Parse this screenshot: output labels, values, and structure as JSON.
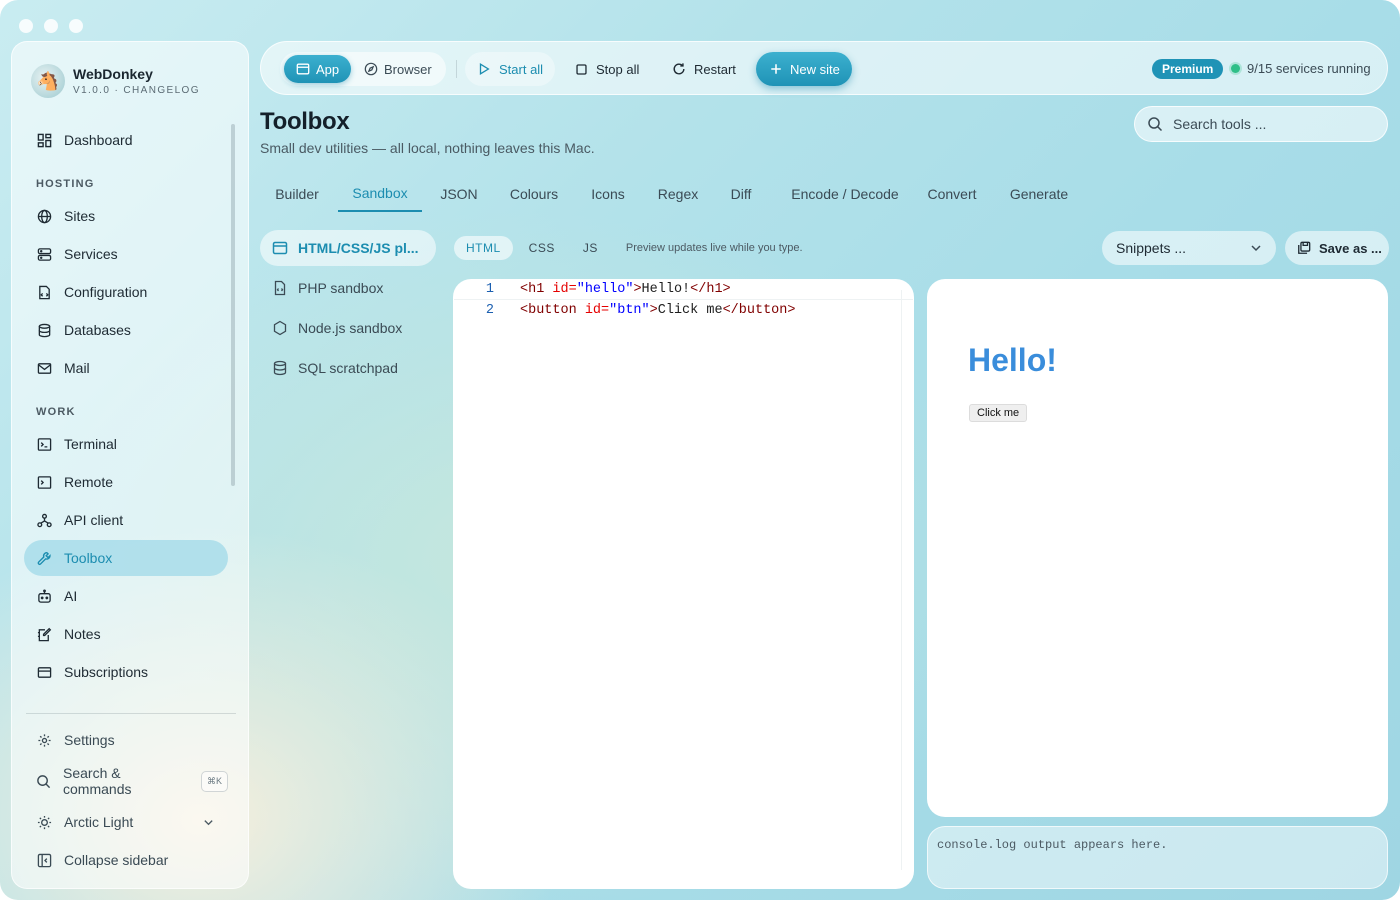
{
  "window": {
    "title": "WebDonkey"
  },
  "sidebar": {
    "brand": {
      "name": "WebDonkey",
      "subtitle": "V1.0.0 · CHANGELOG"
    },
    "items": [
      {
        "label": "Dashboard",
        "icon": "dashboard-icon"
      },
      {
        "label": "Sites",
        "icon": "globe-icon"
      },
      {
        "label": "Services",
        "icon": "server-icon"
      },
      {
        "label": "Configuration",
        "icon": "config-file-icon"
      },
      {
        "label": "Databases",
        "icon": "database-icon"
      },
      {
        "label": "Mail",
        "icon": "mail-icon"
      },
      {
        "label": "Terminal",
        "icon": "terminal-icon"
      },
      {
        "label": "Remote",
        "icon": "remote-terminal-icon"
      },
      {
        "label": "API client",
        "icon": "api-icon"
      },
      {
        "label": "Toolbox",
        "icon": "wrench-icon",
        "active": true
      },
      {
        "label": "AI",
        "icon": "robot-icon"
      },
      {
        "label": "Notes",
        "icon": "notes-icon"
      },
      {
        "label": "Subscriptions",
        "icon": "card-icon"
      }
    ],
    "sections": {
      "hosting": "HOSTING",
      "work": "WORK"
    },
    "footer": {
      "settings": "Settings",
      "search": "Search & commands",
      "search_shortcut": "⌘K",
      "theme": "Arctic Light",
      "collapse": "Collapse sidebar"
    }
  },
  "topbar": {
    "mode_app": "App",
    "mode_browser": "Browser",
    "start_all": "Start all",
    "stop_all": "Stop all",
    "restart": "Restart",
    "new_site": "New site",
    "premium": "Premium",
    "status": "9/15 services running"
  },
  "page": {
    "title": "Toolbox",
    "subtitle": "Small dev utilities — all local, nothing leaves this Mac.",
    "search_placeholder": "Search tools ...",
    "tabs": [
      "Builder",
      "Sandbox",
      "JSON",
      "Colours",
      "Icons",
      "Regex",
      "Diff",
      "Encode / Decode",
      "Convert",
      "Generate"
    ],
    "active_tab": "Sandbox"
  },
  "tools": [
    {
      "label": "HTML/CSS/JS pl...",
      "active": true
    },
    {
      "label": "PHP sandbox"
    },
    {
      "label": "Node.js sandbox"
    },
    {
      "label": "SQL scratchpad"
    }
  ],
  "editor": {
    "lang_tabs": [
      "HTML",
      "CSS",
      "JS"
    ],
    "active_lang": "HTML",
    "hint": "Preview updates live while you type.",
    "snippets": "Snippets ...",
    "save_as": "Save as ...",
    "lines": [
      {
        "n": "1",
        "tag_open": "<h1",
        "attr": " id=",
        "val": "\"hello\"",
        "close": ">",
        "text": "Hello!",
        "end": "</h1>"
      },
      {
        "n": "2",
        "tag_open": "<button",
        "attr": " id=",
        "val": "\"btn\"",
        "close": ">",
        "text": "Click me",
        "end": "</button>"
      }
    ]
  },
  "preview": {
    "heading": "Hello!",
    "button": "Click me"
  },
  "console": {
    "placeholder": "console.log output appears here."
  },
  "colors": {
    "accent": "#1c8db0",
    "status_ok": "#2fbf88",
    "preview_heading": "#3a8ddb"
  }
}
